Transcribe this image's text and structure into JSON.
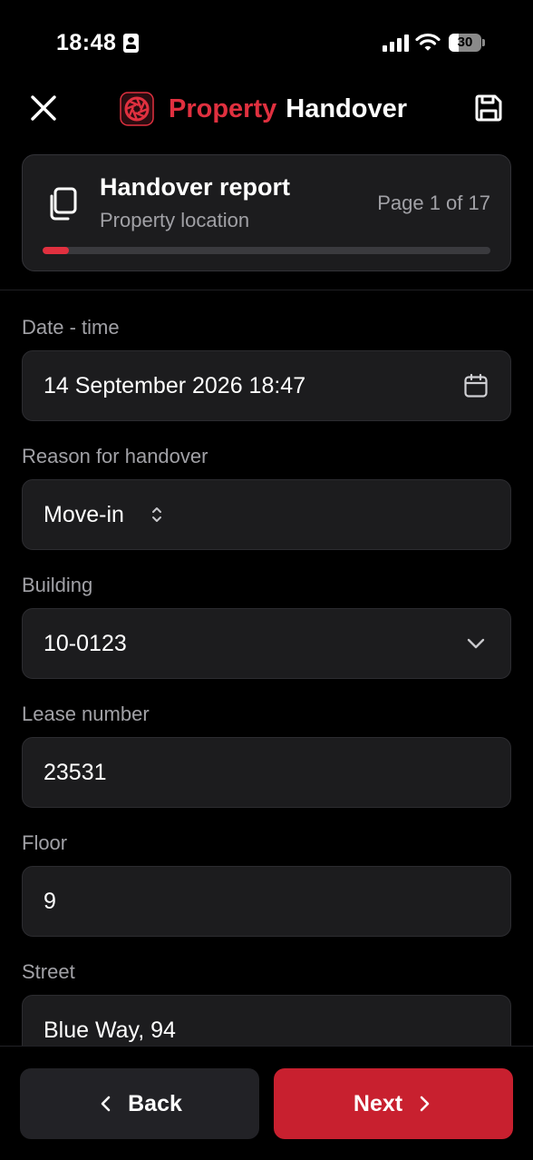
{
  "status_bar": {
    "time": "18:48",
    "battery": "30",
    "battery_level": 0.3
  },
  "header": {
    "title_part1": "Property",
    "title_part2": "Handover",
    "accent_color": "#e0303f",
    "close_icon": "close-icon",
    "save_icon": "save-icon"
  },
  "report": {
    "title": "Handover report",
    "subtitle": "Property location",
    "page": "Page 1 of 17",
    "progress": 0.0588
  },
  "form": {
    "date_label": "Date - time",
    "date_value": "14 September 2026 18:47",
    "reason_label": "Reason for handover",
    "reason_value": "Move-in",
    "building_label": "Building",
    "building_value": "10-0123",
    "lease_label": "Lease number",
    "lease_value": "23531",
    "floor_label": "Floor",
    "floor_value": "9",
    "street_label": "Street",
    "street_value": "Blue Way, 94"
  },
  "footer": {
    "back_label": "Back",
    "next_label": "Next",
    "next_color": "#c8202f"
  }
}
